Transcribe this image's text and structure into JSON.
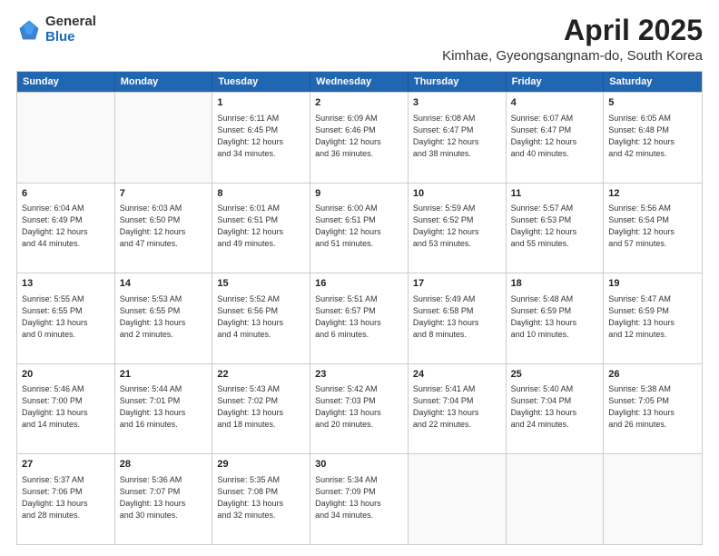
{
  "logo": {
    "general": "General",
    "blue": "Blue"
  },
  "title": "April 2025",
  "subtitle": "Kimhae, Gyeongsangnam-do, South Korea",
  "header_days": [
    "Sunday",
    "Monday",
    "Tuesday",
    "Wednesday",
    "Thursday",
    "Friday",
    "Saturday"
  ],
  "weeks": [
    [
      {
        "day": "",
        "info": ""
      },
      {
        "day": "",
        "info": ""
      },
      {
        "day": "1",
        "info": "Sunrise: 6:11 AM\nSunset: 6:45 PM\nDaylight: 12 hours\nand 34 minutes."
      },
      {
        "day": "2",
        "info": "Sunrise: 6:09 AM\nSunset: 6:46 PM\nDaylight: 12 hours\nand 36 minutes."
      },
      {
        "day": "3",
        "info": "Sunrise: 6:08 AM\nSunset: 6:47 PM\nDaylight: 12 hours\nand 38 minutes."
      },
      {
        "day": "4",
        "info": "Sunrise: 6:07 AM\nSunset: 6:47 PM\nDaylight: 12 hours\nand 40 minutes."
      },
      {
        "day": "5",
        "info": "Sunrise: 6:05 AM\nSunset: 6:48 PM\nDaylight: 12 hours\nand 42 minutes."
      }
    ],
    [
      {
        "day": "6",
        "info": "Sunrise: 6:04 AM\nSunset: 6:49 PM\nDaylight: 12 hours\nand 44 minutes."
      },
      {
        "day": "7",
        "info": "Sunrise: 6:03 AM\nSunset: 6:50 PM\nDaylight: 12 hours\nand 47 minutes."
      },
      {
        "day": "8",
        "info": "Sunrise: 6:01 AM\nSunset: 6:51 PM\nDaylight: 12 hours\nand 49 minutes."
      },
      {
        "day": "9",
        "info": "Sunrise: 6:00 AM\nSunset: 6:51 PM\nDaylight: 12 hours\nand 51 minutes."
      },
      {
        "day": "10",
        "info": "Sunrise: 5:59 AM\nSunset: 6:52 PM\nDaylight: 12 hours\nand 53 minutes."
      },
      {
        "day": "11",
        "info": "Sunrise: 5:57 AM\nSunset: 6:53 PM\nDaylight: 12 hours\nand 55 minutes."
      },
      {
        "day": "12",
        "info": "Sunrise: 5:56 AM\nSunset: 6:54 PM\nDaylight: 12 hours\nand 57 minutes."
      }
    ],
    [
      {
        "day": "13",
        "info": "Sunrise: 5:55 AM\nSunset: 6:55 PM\nDaylight: 13 hours\nand 0 minutes."
      },
      {
        "day": "14",
        "info": "Sunrise: 5:53 AM\nSunset: 6:55 PM\nDaylight: 13 hours\nand 2 minutes."
      },
      {
        "day": "15",
        "info": "Sunrise: 5:52 AM\nSunset: 6:56 PM\nDaylight: 13 hours\nand 4 minutes."
      },
      {
        "day": "16",
        "info": "Sunrise: 5:51 AM\nSunset: 6:57 PM\nDaylight: 13 hours\nand 6 minutes."
      },
      {
        "day": "17",
        "info": "Sunrise: 5:49 AM\nSunset: 6:58 PM\nDaylight: 13 hours\nand 8 minutes."
      },
      {
        "day": "18",
        "info": "Sunrise: 5:48 AM\nSunset: 6:59 PM\nDaylight: 13 hours\nand 10 minutes."
      },
      {
        "day": "19",
        "info": "Sunrise: 5:47 AM\nSunset: 6:59 PM\nDaylight: 13 hours\nand 12 minutes."
      }
    ],
    [
      {
        "day": "20",
        "info": "Sunrise: 5:46 AM\nSunset: 7:00 PM\nDaylight: 13 hours\nand 14 minutes."
      },
      {
        "day": "21",
        "info": "Sunrise: 5:44 AM\nSunset: 7:01 PM\nDaylight: 13 hours\nand 16 minutes."
      },
      {
        "day": "22",
        "info": "Sunrise: 5:43 AM\nSunset: 7:02 PM\nDaylight: 13 hours\nand 18 minutes."
      },
      {
        "day": "23",
        "info": "Sunrise: 5:42 AM\nSunset: 7:03 PM\nDaylight: 13 hours\nand 20 minutes."
      },
      {
        "day": "24",
        "info": "Sunrise: 5:41 AM\nSunset: 7:04 PM\nDaylight: 13 hours\nand 22 minutes."
      },
      {
        "day": "25",
        "info": "Sunrise: 5:40 AM\nSunset: 7:04 PM\nDaylight: 13 hours\nand 24 minutes."
      },
      {
        "day": "26",
        "info": "Sunrise: 5:38 AM\nSunset: 7:05 PM\nDaylight: 13 hours\nand 26 minutes."
      }
    ],
    [
      {
        "day": "27",
        "info": "Sunrise: 5:37 AM\nSunset: 7:06 PM\nDaylight: 13 hours\nand 28 minutes."
      },
      {
        "day": "28",
        "info": "Sunrise: 5:36 AM\nSunset: 7:07 PM\nDaylight: 13 hours\nand 30 minutes."
      },
      {
        "day": "29",
        "info": "Sunrise: 5:35 AM\nSunset: 7:08 PM\nDaylight: 13 hours\nand 32 minutes."
      },
      {
        "day": "30",
        "info": "Sunrise: 5:34 AM\nSunset: 7:09 PM\nDaylight: 13 hours\nand 34 minutes."
      },
      {
        "day": "",
        "info": ""
      },
      {
        "day": "",
        "info": ""
      },
      {
        "day": "",
        "info": ""
      }
    ]
  ]
}
